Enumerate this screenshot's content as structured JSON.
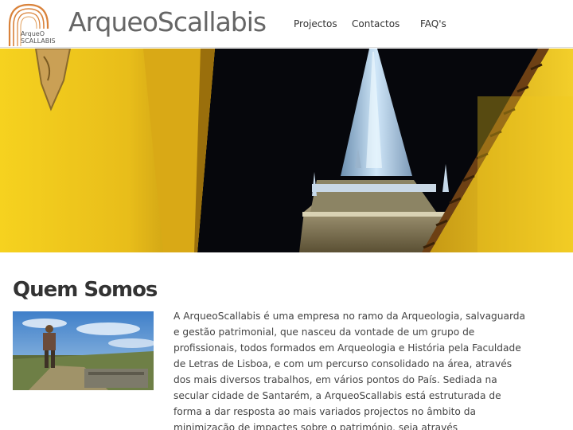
{
  "header": {
    "logo_line1": "ArqueO",
    "logo_line2": "SCALLABIS",
    "site_title": "ArqueoScallabis",
    "nav": [
      {
        "label": "Projectos"
      },
      {
        "label": "Contactos"
      },
      {
        "label": "FAQ's"
      }
    ]
  },
  "colors": {
    "wall_yellow": "#f0c81e",
    "night_sky": "#06070c",
    "logo_arch": "#d9823a"
  },
  "main": {
    "section_title": "Quem Somos",
    "paragraph": "A ArqueoScallabis é uma empresa no ramo da Arqueologia, salvaguarda e gestão patrimonial, que nasceu da vontade de um grupo de profissionais, todos formados em Arqueologia e História pela Faculdade de Letras de Lisboa, e com um percurso consolidado na área, através dos mais diversos trabalhos, em vários pontos do País. Sediada na secular cidade de Santarém, a ArqueoScallabis está estruturada de forma a dar resposta ao mais variados projectos no âmbito da minimização de impactes sobre o património, seja através"
  }
}
